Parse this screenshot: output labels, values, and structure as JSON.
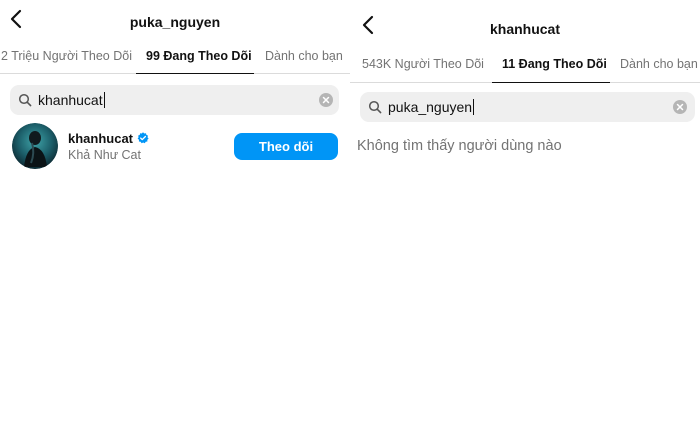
{
  "left": {
    "title": "puka_nguyen",
    "tabs": [
      {
        "label": "2 Triệu Người Theo Dõi",
        "active": false
      },
      {
        "label": "99 Đang Theo Dõi",
        "active": true
      },
      {
        "label": "Dành cho bạn",
        "active": false
      }
    ],
    "search": {
      "value": "khanhucat"
    },
    "results": [
      {
        "username": "khanhucat",
        "full_name": "Khả Như Cat",
        "verified": true,
        "button_label": "Theo dõi"
      }
    ]
  },
  "right": {
    "title": "khanhucat",
    "tabs": [
      {
        "label": "543K Người Theo Dõi",
        "active": false
      },
      {
        "label": "11 Đang Theo Dõi",
        "active": true
      },
      {
        "label": "Dành cho bạn",
        "active": false
      }
    ],
    "search": {
      "value": "puka_nguyen"
    },
    "empty_message": "Không tìm thấy người dùng nào"
  },
  "colors": {
    "accent": "#0095f6",
    "muted_text": "#737373",
    "search_bg": "#efefef"
  },
  "icons": [
    "chevron-left-icon",
    "search-icon",
    "clear-icon",
    "verified-badge-icon"
  ]
}
